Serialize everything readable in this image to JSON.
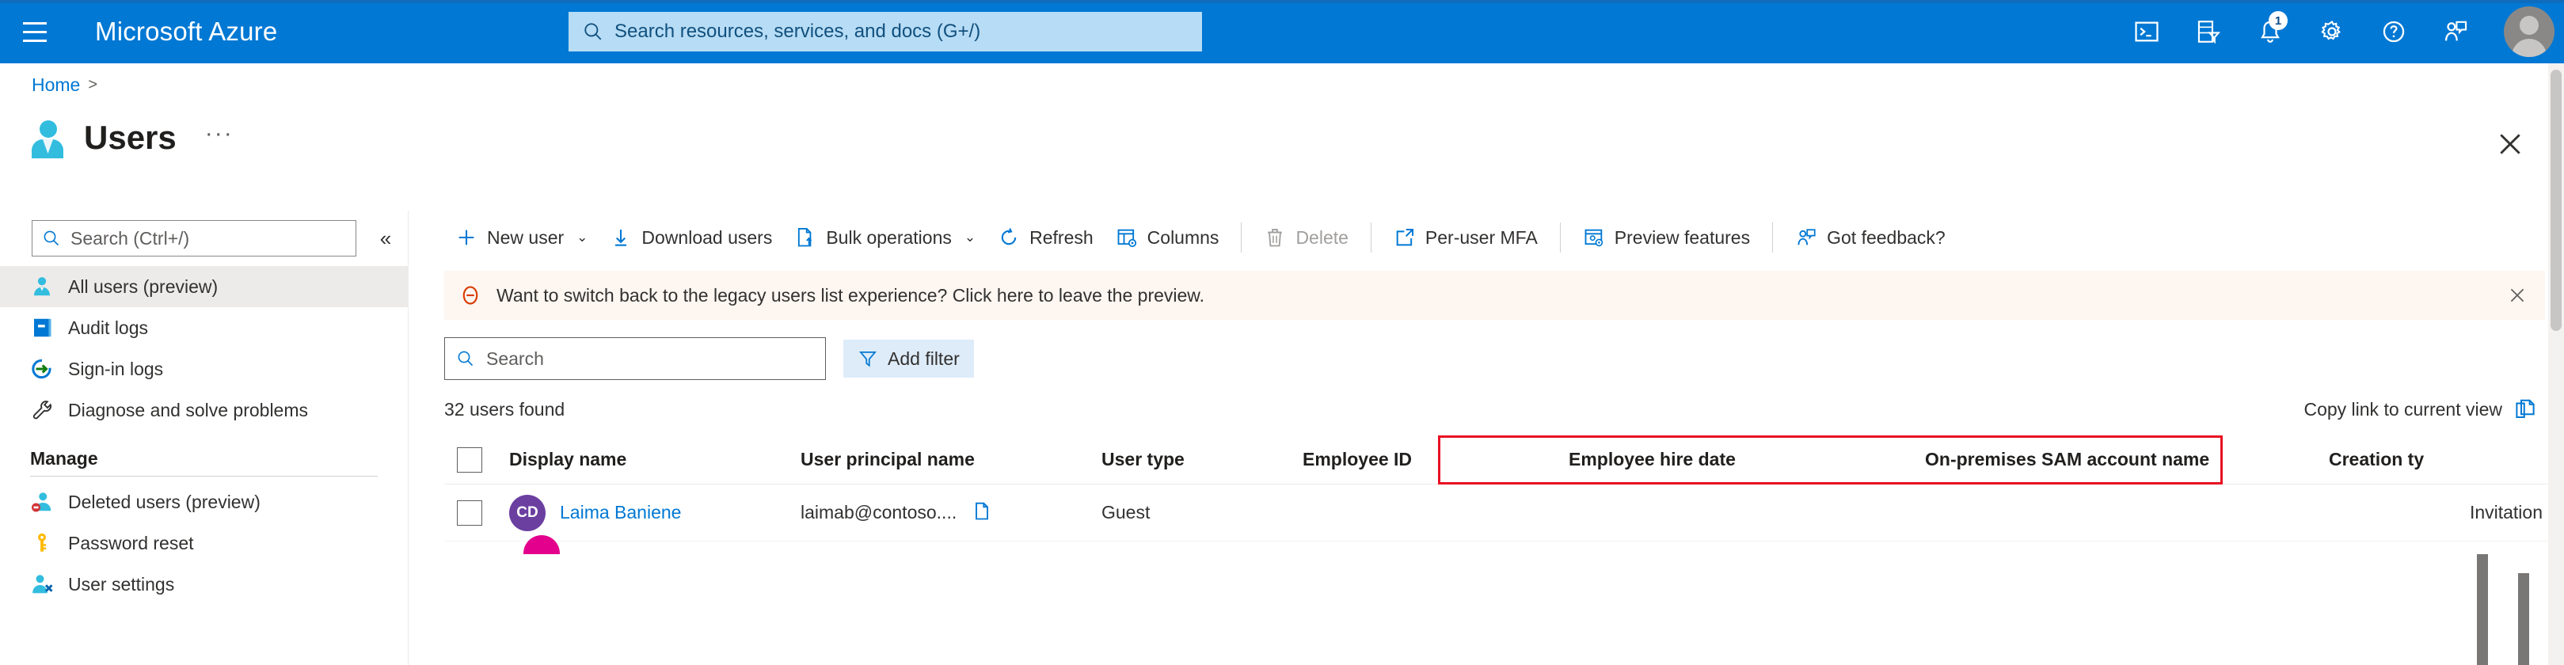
{
  "topbar": {
    "menu_icon": "hamburger-icon",
    "brand": "Microsoft Azure",
    "search_placeholder": "Search resources, services, and docs (G+/)",
    "icons": [
      {
        "name": "cloud-shell-icon",
        "label": "Cloud Shell"
      },
      {
        "name": "directories-subscriptions-icon",
        "label": "Directories + subscriptions"
      },
      {
        "name": "notifications-bell-icon",
        "label": "Notifications",
        "badge": "1"
      },
      {
        "name": "settings-gear-icon",
        "label": "Settings"
      },
      {
        "name": "help-question-icon",
        "label": "Help"
      },
      {
        "name": "feedback-person-icon",
        "label": "Feedback"
      }
    ],
    "avatar": "account-avatar"
  },
  "breadcrumb": {
    "items": [
      "Home"
    ],
    "separator": ">"
  },
  "page": {
    "title": "Users",
    "title_icon": "users-icon",
    "more_label": "···",
    "close_label": "Close"
  },
  "sidebar": {
    "search_placeholder": "Search (Ctrl+/)",
    "collapse_label": "«",
    "items": [
      {
        "label": "All users (preview)",
        "icon": "user-icon",
        "active": true
      },
      {
        "label": "Audit logs",
        "icon": "audit-log-icon",
        "active": false
      },
      {
        "label": "Sign-in logs",
        "icon": "sign-in-icon",
        "active": false
      },
      {
        "label": "Diagnose and solve problems",
        "icon": "wrench-icon",
        "active": false
      }
    ],
    "group_label": "Manage",
    "manage_items": [
      {
        "label": "Deleted users (preview)",
        "icon": "deleted-user-icon"
      },
      {
        "label": "Password reset",
        "icon": "key-icon"
      },
      {
        "label": "User settings",
        "icon": "user-settings-icon"
      }
    ]
  },
  "toolbar": {
    "items": [
      {
        "label": "New user",
        "icon": "plus-icon",
        "caret": true,
        "disabled": false
      },
      {
        "label": "Download users",
        "icon": "download-icon",
        "caret": false,
        "disabled": false
      },
      {
        "label": "Bulk operations",
        "icon": "bulk-operations-icon",
        "caret": true,
        "disabled": false
      },
      {
        "label": "Refresh",
        "icon": "refresh-icon",
        "caret": false,
        "disabled": false
      },
      {
        "label": "Columns",
        "icon": "columns-icon",
        "caret": false,
        "disabled": false
      },
      {
        "label": "Delete",
        "icon": "trash-icon",
        "caret": false,
        "disabled": true
      },
      {
        "label": "Per-user MFA",
        "icon": "external-link-icon",
        "caret": false,
        "disabled": false
      },
      {
        "label": "Preview features",
        "icon": "preview-features-icon",
        "caret": false,
        "disabled": false
      },
      {
        "label": "Got feedback?",
        "icon": "feedback-person-icon",
        "caret": false,
        "disabled": false
      }
    ]
  },
  "banner": {
    "icon": "info-minus-icon",
    "text": "Want to switch back to the legacy users list experience? Click here to leave the preview.",
    "close_label": "Dismiss",
    "accent": "#d83b01",
    "background": "#fdf6f1"
  },
  "filter": {
    "search_placeholder": "Search",
    "add_filter_label": "Add filter",
    "filter_icon": "funnel-icon"
  },
  "results": {
    "count_text": "32 users found",
    "copy_link_label": "Copy link to current view",
    "copy_icon": "copy-pages-icon"
  },
  "table": {
    "columns": [
      "Display name",
      "User principal name",
      "User type",
      "Employee ID",
      "Employee hire date",
      "On-premises SAM account name",
      "Creation ty"
    ],
    "highlight": {
      "columns": [
        "Employee ID",
        "Employee hire date",
        "On-premises SAM account name"
      ],
      "color": "#e81123"
    },
    "rows": [
      {
        "initials": "CD",
        "avatar_color": "#6b3fa0",
        "display_name": "Laima Baniene",
        "user_principal_name": "laimab@contoso....",
        "copy_icon": "copy-icon",
        "user_type": "Guest",
        "employee_id": "",
        "employee_hire_date": "",
        "on_premises_sam_account_name": "",
        "creation_type": "Invitation"
      }
    ]
  },
  "colors": {
    "azure_blue": "#0078d4",
    "link_blue": "#0078d4",
    "highlight_red": "#e81123",
    "banner_bg": "#fdf6f1"
  }
}
